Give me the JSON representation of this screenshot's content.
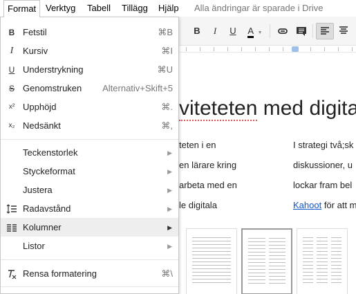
{
  "menubar": {
    "items": [
      "Format",
      "Verktyg",
      "Tabell",
      "Tillägg",
      "Hjälp"
    ],
    "saved_status": "Alla ändringar är sparade i Drive"
  },
  "toolbar": {
    "bold_label": "B",
    "italic_label": "I",
    "underline_label": "U",
    "text_color_label": "A",
    "text_color": "#000000"
  },
  "menu": {
    "group1": [
      {
        "icon": "bold-icon",
        "label": "Fetstil",
        "shortcut": "⌘B"
      },
      {
        "icon": "italic-icon",
        "label": "Kursiv",
        "shortcut": "⌘I"
      },
      {
        "icon": "underline-icon",
        "label": "Understrykning",
        "shortcut": "⌘U"
      },
      {
        "icon": "strikethrough-icon",
        "label": "Genomstruken",
        "shortcut": "Alternativ+Skift+5"
      },
      {
        "icon": "superscript-icon",
        "label": "Upphöjd",
        "shortcut": "⌘."
      },
      {
        "icon": "subscript-icon",
        "label": "Nedsänkt",
        "shortcut": "⌘,"
      }
    ],
    "group2": [
      {
        "icon": "",
        "label": "Teckenstorlek",
        "submenu": true
      },
      {
        "icon": "",
        "label": "Styckeformat",
        "submenu": true
      },
      {
        "icon": "",
        "label": "Justera",
        "submenu": true
      },
      {
        "icon": "line-spacing-icon",
        "label": "Radavstånd",
        "submenu": true
      },
      {
        "icon": "columns-icon",
        "label": "Kolumner",
        "submenu": true,
        "highlighted": true
      },
      {
        "icon": "",
        "label": "Listor",
        "submenu": true
      }
    ],
    "group3": [
      {
        "icon": "clear-formatting-icon",
        "label": "Rensa formatering",
        "shortcut": "⌘\\"
      }
    ]
  },
  "document": {
    "heading": {
      "prefix": "",
      "misspelled": "viteteten",
      "rest": " med digita"
    },
    "column1": [
      "teten i en",
      "en lärare kring",
      "arbeta med en",
      "le digitala"
    ],
    "column2": [
      "I strategi två;sk",
      "diskussioner, u",
      "lockar fram bel"
    ],
    "column2_last": {
      "link": "Kahoot",
      "rest": " för att m"
    }
  },
  "columns_panel": {
    "options": [
      "one-column",
      "two-columns",
      "three-columns"
    ],
    "selected": "two-columns"
  }
}
